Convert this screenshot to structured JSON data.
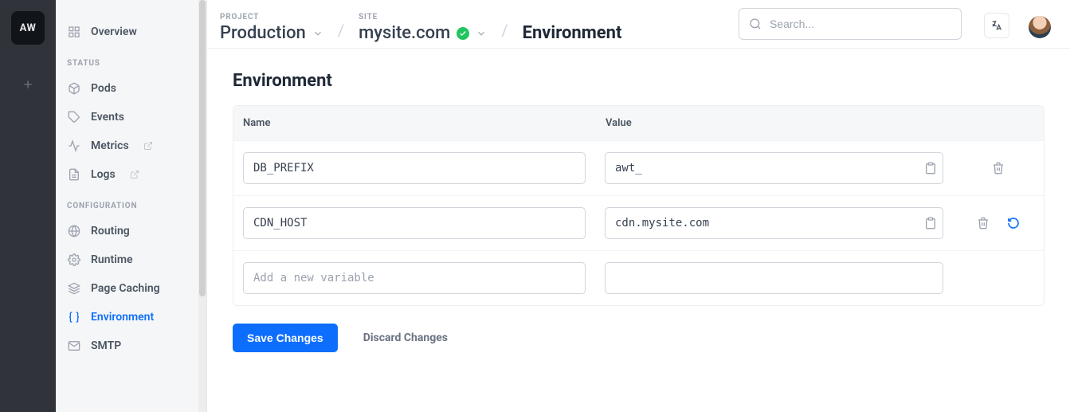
{
  "rail": {
    "logo_text": "AW"
  },
  "breadcrumb": {
    "project_label": "PROJECT",
    "project_value": "Production",
    "site_label": "SITE",
    "site_value": "mysite.com",
    "page_value": "Environment"
  },
  "search": {
    "placeholder": "Search..."
  },
  "sidebar": {
    "overview": "Overview",
    "section_status": "STATUS",
    "pods": "Pods",
    "events": "Events",
    "metrics": "Metrics",
    "logs": "Logs",
    "section_config": "CONFIGURATION",
    "routing": "Routing",
    "runtime": "Runtime",
    "page_caching": "Page Caching",
    "environment": "Environment",
    "smtp": "SMTP"
  },
  "page": {
    "title": "Environment",
    "col_name": "Name",
    "col_value": "Value",
    "new_placeholder": "Add a new variable",
    "rows": [
      {
        "name": "DB_PREFIX",
        "value": "awt_"
      },
      {
        "name": "CDN_HOST",
        "value": "cdn.mysite.com"
      }
    ],
    "save_label": "Save Changes",
    "discard_label": "Discard Changes"
  }
}
